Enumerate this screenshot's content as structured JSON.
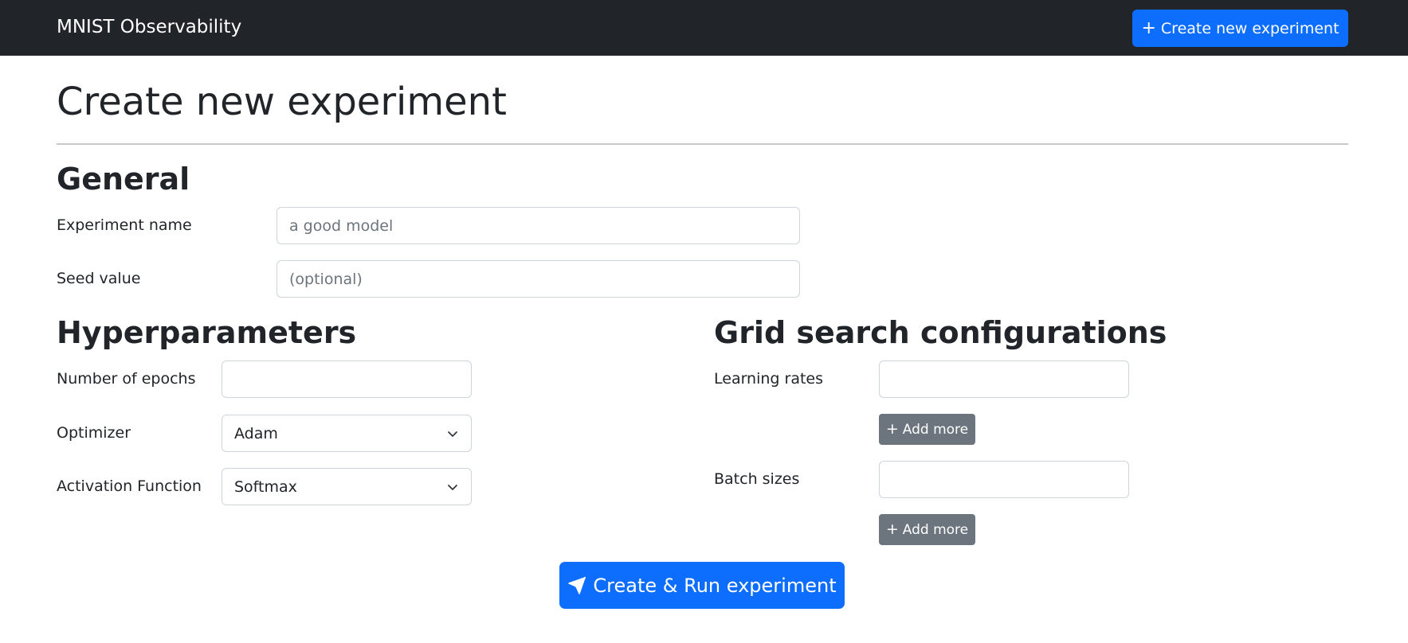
{
  "navbar": {
    "brand": "MNIST Observability",
    "create_button": "Create new experiment"
  },
  "page": {
    "title": "Create new experiment"
  },
  "general": {
    "title": "General",
    "experiment_name_label": "Experiment name",
    "experiment_name_placeholder": "a good model",
    "seed_label": "Seed value",
    "seed_placeholder": "(optional)"
  },
  "hyperparameters": {
    "title": "Hyperparameters",
    "epochs_label": "Number of epochs",
    "epochs_value": "",
    "optimizer_label": "Optimizer",
    "optimizer_value": "Adam",
    "activation_label": "Activation Function",
    "activation_value": "Softmax"
  },
  "grid_search": {
    "title": "Grid search configurations",
    "learning_rates_label": "Learning rates",
    "learning_rates_value": "",
    "batch_sizes_label": "Batch sizes",
    "batch_sizes_value": "",
    "add_more_label": "Add more"
  },
  "submit": {
    "label": "Create & Run experiment"
  },
  "icons": {
    "plus": "plus-icon",
    "chevron": "chevron-down-icon",
    "send": "send-icon"
  },
  "colors": {
    "navbar": "#212529",
    "primary": "#0d6efd",
    "secondary": "#6c757d"
  }
}
